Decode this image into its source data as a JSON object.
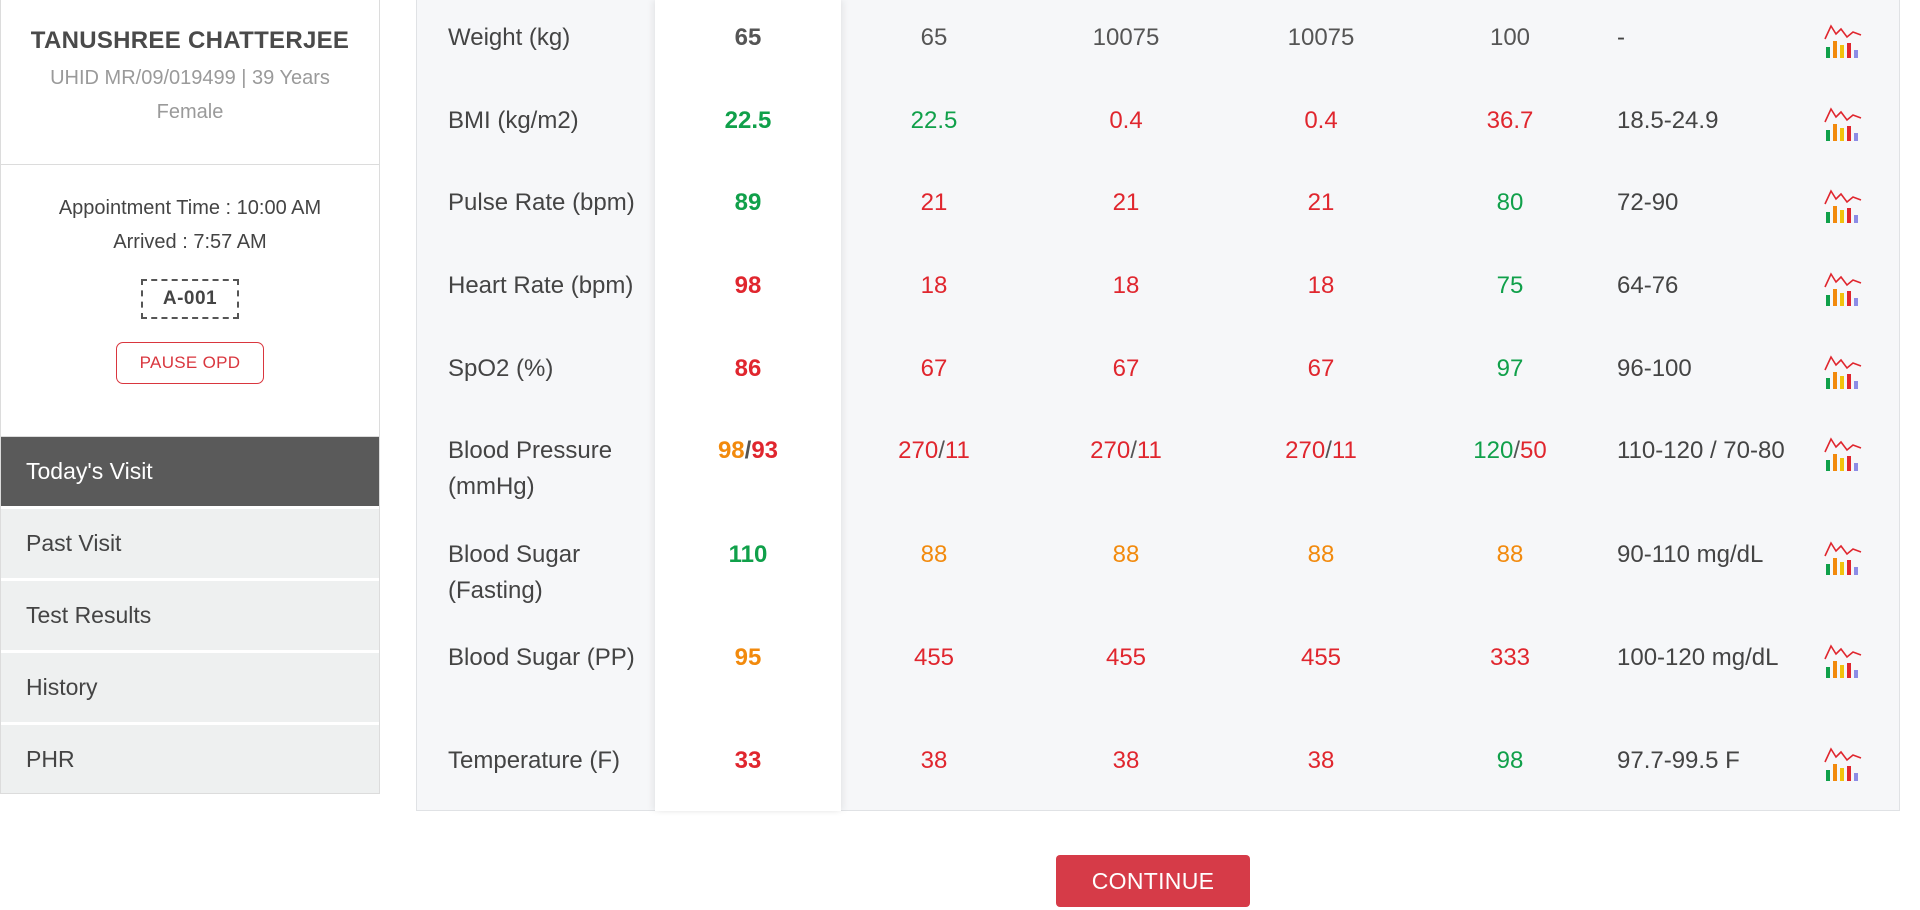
{
  "patient": {
    "name": "TANUSHREE CHATTERJEE",
    "id_age": "UHID MR/09/019499 | 39 Years",
    "gender": "Female"
  },
  "appointment": {
    "time": "Appointment Time : 10:00 AM",
    "arrived": "Arrived : 7:57 AM",
    "token": "A-001",
    "pause_label": "PAUSE OPD"
  },
  "nav": {
    "items": [
      {
        "label": "Today's Visit",
        "active": true
      },
      {
        "label": "Past Visit",
        "active": false
      },
      {
        "label": "Test Results",
        "active": false
      },
      {
        "label": "History",
        "active": false
      },
      {
        "label": "PHR",
        "active": false
      }
    ]
  },
  "vitals": {
    "rows": [
      {
        "label": "Weight (kg)",
        "today": {
          "text": "65",
          "color": "dark"
        },
        "past": [
          {
            "text": "65",
            "color": "dark"
          },
          {
            "text": "10075",
            "color": "dark"
          },
          {
            "text": "10075",
            "color": "dark"
          },
          {
            "text": "100",
            "color": "dark"
          }
        ],
        "range": "-",
        "trend_icon": "trend-chart-icon"
      },
      {
        "label": "BMI (kg/m2)",
        "today": {
          "text": "22.5",
          "color": "green"
        },
        "past": [
          {
            "text": "22.5",
            "color": "green"
          },
          {
            "text": "0.4",
            "color": "red"
          },
          {
            "text": "0.4",
            "color": "red"
          },
          {
            "text": "36.7",
            "color": "red"
          }
        ],
        "range": "18.5-24.9",
        "trend_icon": "trend-chart-icon"
      },
      {
        "label": "Pulse Rate (bpm)",
        "today": {
          "text": "89",
          "color": "green"
        },
        "past": [
          {
            "text": "21",
            "color": "red"
          },
          {
            "text": "21",
            "color": "red"
          },
          {
            "text": "21",
            "color": "red"
          },
          {
            "text": "80",
            "color": "green"
          }
        ],
        "range": "72-90",
        "trend_icon": "trend-chart-icon"
      },
      {
        "label": "Heart Rate (bpm)",
        "today": {
          "text": "98",
          "color": "red"
        },
        "past": [
          {
            "text": "18",
            "color": "red"
          },
          {
            "text": "18",
            "color": "red"
          },
          {
            "text": "18",
            "color": "red"
          },
          {
            "text": "75",
            "color": "green"
          }
        ],
        "range": "64-76",
        "trend_icon": "trend-chart-icon"
      },
      {
        "label": "SpO2 (%)",
        "today": {
          "text": "86",
          "color": "red"
        },
        "past": [
          {
            "text": "67",
            "color": "red"
          },
          {
            "text": "67",
            "color": "red"
          },
          {
            "text": "67",
            "color": "red"
          },
          {
            "text": "97",
            "color": "green"
          }
        ],
        "range": "96-100",
        "trend_icon": "trend-chart-icon"
      },
      {
        "label": "Blood Pressure (mmHg)",
        "today": {
          "sys": "98",
          "sys_color": "orange",
          "dia": "93",
          "dia_color": "red"
        },
        "past": [
          {
            "sys": "270",
            "sys_color": "red",
            "dia": "11",
            "dia_color": "red"
          },
          {
            "sys": "270",
            "sys_color": "red",
            "dia": "11",
            "dia_color": "red"
          },
          {
            "sys": "270",
            "sys_color": "red",
            "dia": "11",
            "dia_color": "red"
          },
          {
            "sys": "120",
            "sys_color": "green",
            "dia": "50",
            "dia_color": "red"
          }
        ],
        "range": "110-120 / 70-80",
        "trend_icon": "trend-chart-icon"
      },
      {
        "label": "Blood Sugar (Fasting)",
        "today": {
          "text": "110",
          "color": "green"
        },
        "past": [
          {
            "text": "88",
            "color": "orange"
          },
          {
            "text": "88",
            "color": "orange"
          },
          {
            "text": "88",
            "color": "orange"
          },
          {
            "text": "88",
            "color": "orange"
          }
        ],
        "range": "90-110 mg/dL",
        "trend_icon": "trend-chart-icon"
      },
      {
        "label": "Blood Sugar (PP)",
        "today": {
          "text": "95",
          "color": "orange"
        },
        "past": [
          {
            "text": "455",
            "color": "red"
          },
          {
            "text": "455",
            "color": "red"
          },
          {
            "text": "455",
            "color": "red"
          },
          {
            "text": "333",
            "color": "red"
          }
        ],
        "range": "100-120 mg/dL",
        "trend_icon": "trend-chart-icon"
      },
      {
        "label": "Temperature (F)",
        "today": {
          "text": "33",
          "color": "red"
        },
        "past": [
          {
            "text": "38",
            "color": "red"
          },
          {
            "text": "38",
            "color": "red"
          },
          {
            "text": "38",
            "color": "red"
          },
          {
            "text": "98",
            "color": "green"
          }
        ],
        "range": "97.7-99.5 F",
        "trend_icon": "trend-chart-icon"
      }
    ]
  },
  "footer": {
    "continue_label": "CONTINUE"
  },
  "colors": {
    "green": "#10a04a",
    "red": "#e0262e",
    "orange": "#f28a0d",
    "active_nav": "#5a5a5a",
    "primary_button": "#d63b48"
  }
}
